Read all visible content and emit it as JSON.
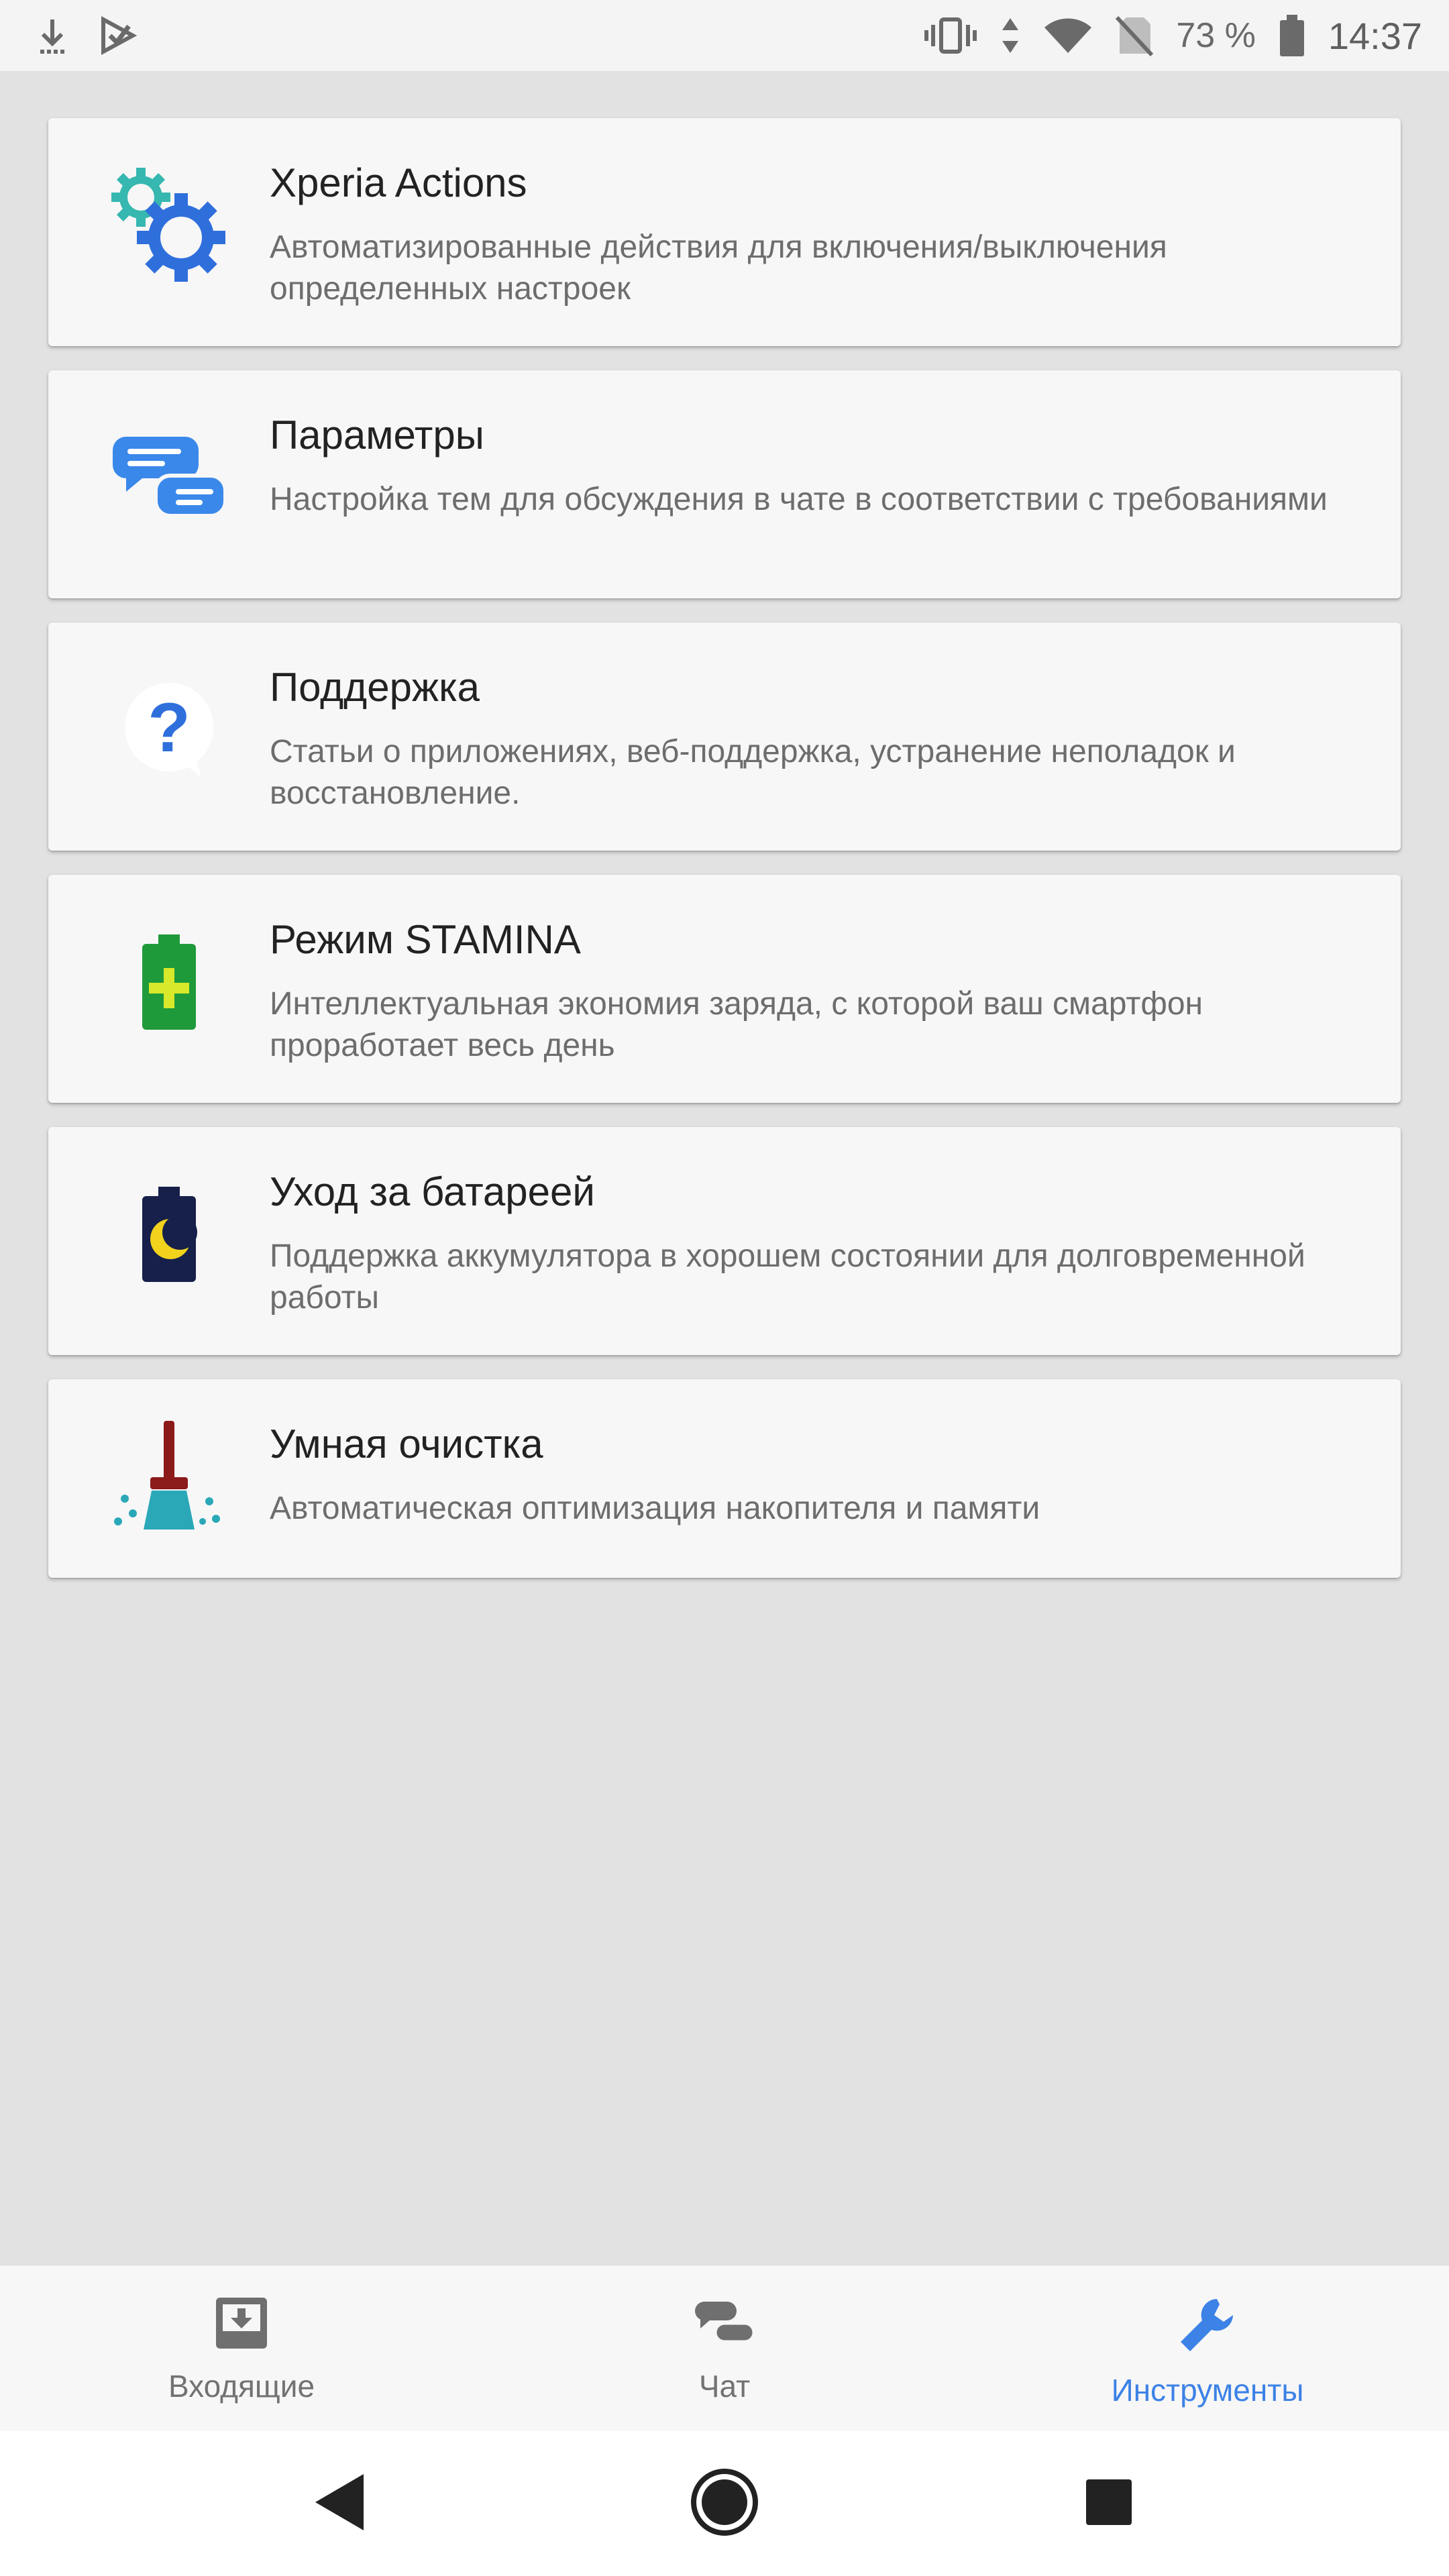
{
  "status_bar": {
    "battery_percent": "73 %",
    "time": "14:37",
    "icons": [
      "download-icon",
      "play-store-icon",
      "vibrate-icon",
      "data-arrows-icon",
      "wifi-icon",
      "no-sim-icon",
      "battery-icon"
    ]
  },
  "cards": [
    {
      "title": "Xperia Actions",
      "description": "Автоматизированные действия для включения/выключения определенных настроек",
      "icon": "gears-icon"
    },
    {
      "title": "Параметры",
      "description": "Настройка тем для обсуждения в чате в соответствии с требованиями",
      "icon": "chat-bubbles-icon"
    },
    {
      "title": "Поддержка",
      "description": "Статьи о приложениях, веб-поддержка, устранение неполадок и восстановление.",
      "icon": "question-bubble-icon"
    },
    {
      "title": "Режим STAMINA",
      "description": "Интеллектуальная экономия заряда, с которой ваш смартфон проработает весь день",
      "icon": "battery-plus-icon"
    },
    {
      "title": "Уход за батареей",
      "description": "Поддержка аккумулятора в хорошем состоянии для долговременной работы",
      "icon": "battery-moon-icon"
    },
    {
      "title": "Умная очистка",
      "description": "Автоматическая оптимизация накопителя и памяти",
      "icon": "broom-icon"
    }
  ],
  "bottom_nav": {
    "items": [
      {
        "label": "Входящие",
        "icon": "inbox-icon",
        "active": false
      },
      {
        "label": "Чат",
        "icon": "chat-icon",
        "active": false
      },
      {
        "label": "Инструменты",
        "icon": "wrench-icon",
        "active": true
      }
    ]
  },
  "colors": {
    "accent": "#3d82e6",
    "background": "#e2e2e2",
    "card": "#f7f7f7"
  },
  "system_nav": {
    "buttons": [
      "back-icon",
      "home-icon",
      "recents-icon"
    ]
  }
}
